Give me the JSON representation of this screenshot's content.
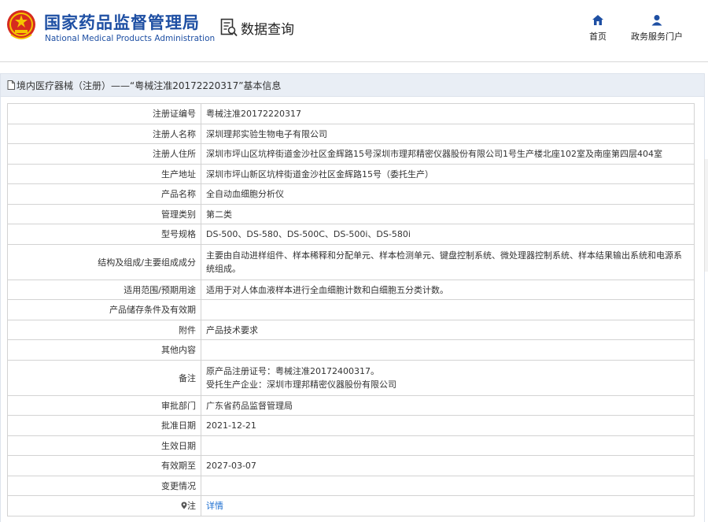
{
  "header": {
    "brand_cn": "国家药品监督管理局",
    "brand_en": "National Medical Products Administration",
    "query_label": "数据查询",
    "nav": [
      {
        "label": "首页",
        "icon": "home-icon"
      },
      {
        "label": "政务服务门户",
        "icon": "user-icon"
      }
    ]
  },
  "breadcrumb": {
    "text": "境内医疗器械（注册）——“粤械注准20172220317”基本信息"
  },
  "fields": [
    {
      "key": "注册证编号",
      "value": "粤械注准20172220317"
    },
    {
      "key": "注册人名称",
      "value": "深圳理邦实验生物电子有限公司"
    },
    {
      "key": "注册人住所",
      "value": "深圳市坪山区坑梓街道金沙社区金辉路15号深圳市理邦精密仪器股份有限公司1号生产楼北座102室及南座第四层404室"
    },
    {
      "key": "生产地址",
      "value": "深圳市坪山新区坑梓街道金沙社区金辉路15号（委托生产）"
    },
    {
      "key": "产品名称",
      "value": "全自动血细胞分析仪"
    },
    {
      "key": "管理类别",
      "value": "第二类"
    },
    {
      "key": "型号规格",
      "value": "DS-500、DS-580、DS-500C、DS-500i、DS-580i"
    },
    {
      "key": "结构及组成/主要组成成分",
      "value": "主要由自动进样组件、样本稀释和分配单元、样本检测单元、键盘控制系统、微处理器控制系统、样本结果输出系统和电源系统组成。"
    },
    {
      "key": "适用范围/预期用途",
      "value": "适用于对人体血液样本进行全血细胞计数和白细胞五分类计数。"
    },
    {
      "key": "产品储存条件及有效期",
      "value": ""
    },
    {
      "key": "附件",
      "value": "产品技术要求"
    },
    {
      "key": "其他内容",
      "value": ""
    },
    {
      "key": "备注",
      "value_line1": "原产品注册证号：粤械注准20172400317。",
      "value_line2": "受托生产企业：深圳市理邦精密仪器股份有限公司"
    },
    {
      "key": "审批部门",
      "value": "广东省药品监督管理局"
    },
    {
      "key": "批准日期",
      "value": "2021-12-21"
    },
    {
      "key": "生效日期",
      "value": ""
    },
    {
      "key": "有效期至",
      "value": "2027-03-07"
    },
    {
      "key": "变更情况",
      "value": ""
    },
    {
      "key": "注",
      "value": "详情",
      "icon": "location-pin-icon"
    }
  ]
}
